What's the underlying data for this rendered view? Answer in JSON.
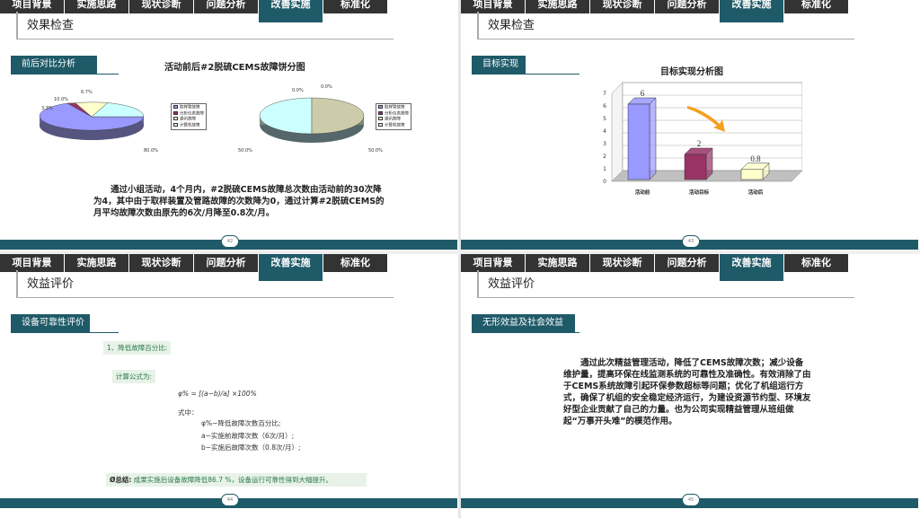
{
  "nav_tabs": [
    "项目背景",
    "实施思路",
    "现状诊断",
    "问题分析",
    "改善实施",
    "标准化"
  ],
  "slide1": {
    "title": "效果检查",
    "tag": "前后对比分析",
    "chart_title": "活动前后#2脱硫CEMS故障饼分图",
    "legend": [
      "取样管故障",
      "分析仪表故障",
      "通讯故障",
      "计算机故障"
    ],
    "pie1_labels": [
      "6.7%",
      "10.0%",
      "3.3%",
      "80.0%"
    ],
    "pie2_labels": [
      "0.0%",
      "0.0%",
      "50.0%",
      "50.0%"
    ],
    "body": "通过小组活动，4个月内，#2脱硫CEMS故障总次数由活动前的30次降为4，其中由于取样装置及管路故障的次数降为0，通过计算#2脱硫CEMS的月平均故障次数由原先的6次/月降至0.8次/月。",
    "page": "42"
  },
  "slide2": {
    "title": "效果检查",
    "tag": "目标实现",
    "page": "43"
  },
  "chart_data": {
    "type": "bar",
    "title": "目标实现分析图",
    "categories": [
      "活动前",
      "活动目标",
      "活动后"
    ],
    "values": [
      6,
      2,
      0.8
    ],
    "value_labels": [
      "6",
      "2",
      "0.8"
    ],
    "yticks": [
      "0",
      "1",
      "2",
      "3",
      "4",
      "5",
      "6",
      "7"
    ],
    "ylim": [
      0,
      7
    ],
    "colors": [
      "#9999ff",
      "#993366",
      "#ffffcc"
    ]
  },
  "slide3": {
    "title": "效益评价",
    "tag": "设备可靠性评价",
    "item1": "1、降低故障百分比:",
    "formula_label": "计算公式为:",
    "formula": "φ% = [(a−b)/a] ×100%",
    "where": "式中：",
    "def1": "φ%−降低故障次数百分比;",
    "def2": "a−实施前故障次数（6次/月）;",
    "def3": "b−实施后故障次数（0.8次/月）;",
    "summary_lead": "Ø总结:",
    "summary": "成果实施后设备故障降低86.7 %，设备运行可靠性得到大幅提升。",
    "page": "44"
  },
  "slide4": {
    "title": "效益评价",
    "tag": "无形效益及社会效益",
    "body": "通过此次精益管理活动，降低了CEMS故障次数；减少设备维护量，提高环保在线监测系统的可靠性及准确性。有效消除了由于CEMS系统故障引起环保参数超标等问题；优化了机组运行方式，确保了机组的安全稳定经济运行，为建设资源节约型、环境友好型企业贡献了自己的力量。也为公司实现精益管理从班组做起“万事开头难”的模范作用。",
    "page": "45"
  }
}
